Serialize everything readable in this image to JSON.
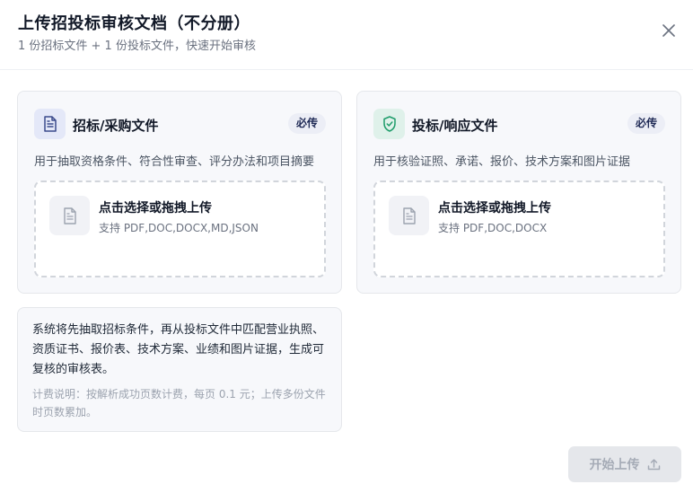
{
  "dialog": {
    "title": "上传招投标审核文档（不分册）",
    "subtitle": "1 份招标文件 + 1 份投标文件，快速开始审核",
    "close_icon": "close-icon"
  },
  "tender_card": {
    "title": "招标/采购文件",
    "badge": "必传",
    "icon": "document-icon",
    "accent": "#3b4a8c",
    "description": "用于抽取资格条件、符合性审查、评分办法和项目摘要",
    "dropzone": {
      "title": "点击选择或拖拽上传",
      "hint": "支持 PDF,DOC,DOCX,MD,JSON"
    }
  },
  "bid_card": {
    "title": "投标/响应文件",
    "badge": "必传",
    "icon": "shield-check-icon",
    "accent": "#1f9d6b",
    "description": "用于核验证照、承诺、报价、技术方案和图片证据",
    "dropzone": {
      "title": "点击选择或拖拽上传",
      "hint": "支持 PDF,DOC,DOCX"
    }
  },
  "info": {
    "text": "系统将先抽取招标条件，再从投标文件中匹配营业执照、资质证书、报价表、技术方案、业绩和图片证据，生成可复核的审核表。",
    "note": "计费说明：按解析成功页数计费，每页 0.1 元；上传多份文件时页数累加。"
  },
  "actions": {
    "start_label": "开始上传",
    "start_icon": "upload-icon",
    "start_disabled": true
  }
}
